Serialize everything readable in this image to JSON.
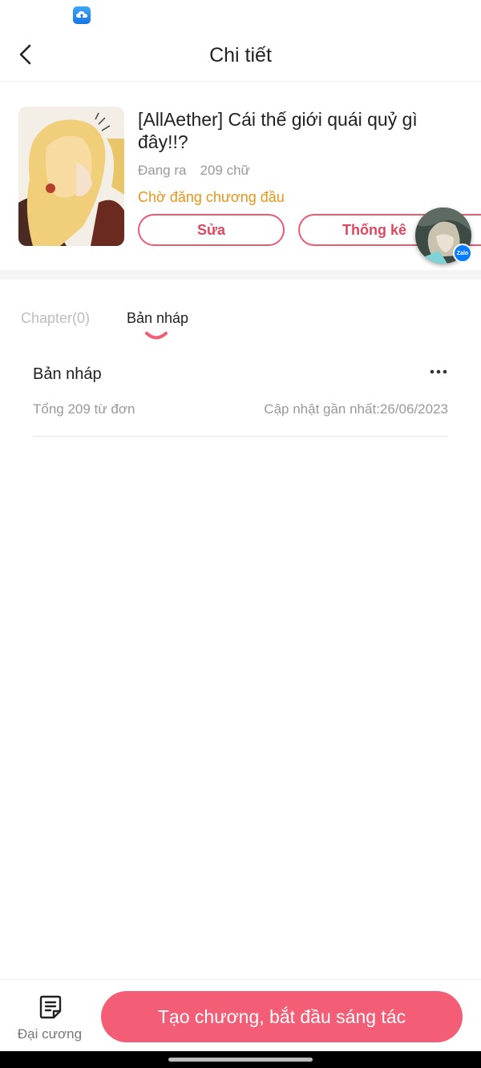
{
  "header": {
    "title": "Chi tiết",
    "back_icon": "chevron-left-icon"
  },
  "book": {
    "title": "[AllAether] Cái thế giới quái quỷ gì đây!!?",
    "status": "Đang ra",
    "word_count": "209 chữ",
    "publish_state": "Chờ đăng chương đầu",
    "edit_label": "Sửa",
    "stats_label": "Thống kê"
  },
  "zalo": {
    "badge_text": "Zalo"
  },
  "tabs": [
    {
      "label": "Chapter(0)",
      "active": false
    },
    {
      "label": "Bản nháp",
      "active": true
    }
  ],
  "drafts": [
    {
      "title": "Bản nháp",
      "total": "Tổng 209 từ đơn",
      "updated": "Cập nhật gần nhất:26/06/2023"
    }
  ],
  "bottom": {
    "outline_label": "Đại cương",
    "create_label": "Tạo chương, bắt đầu sáng tác"
  },
  "colors": {
    "accent": "#f45d76",
    "outline_accent": "#ec5a72",
    "status_orange": "#e8941a",
    "muted_text": "#999999"
  }
}
